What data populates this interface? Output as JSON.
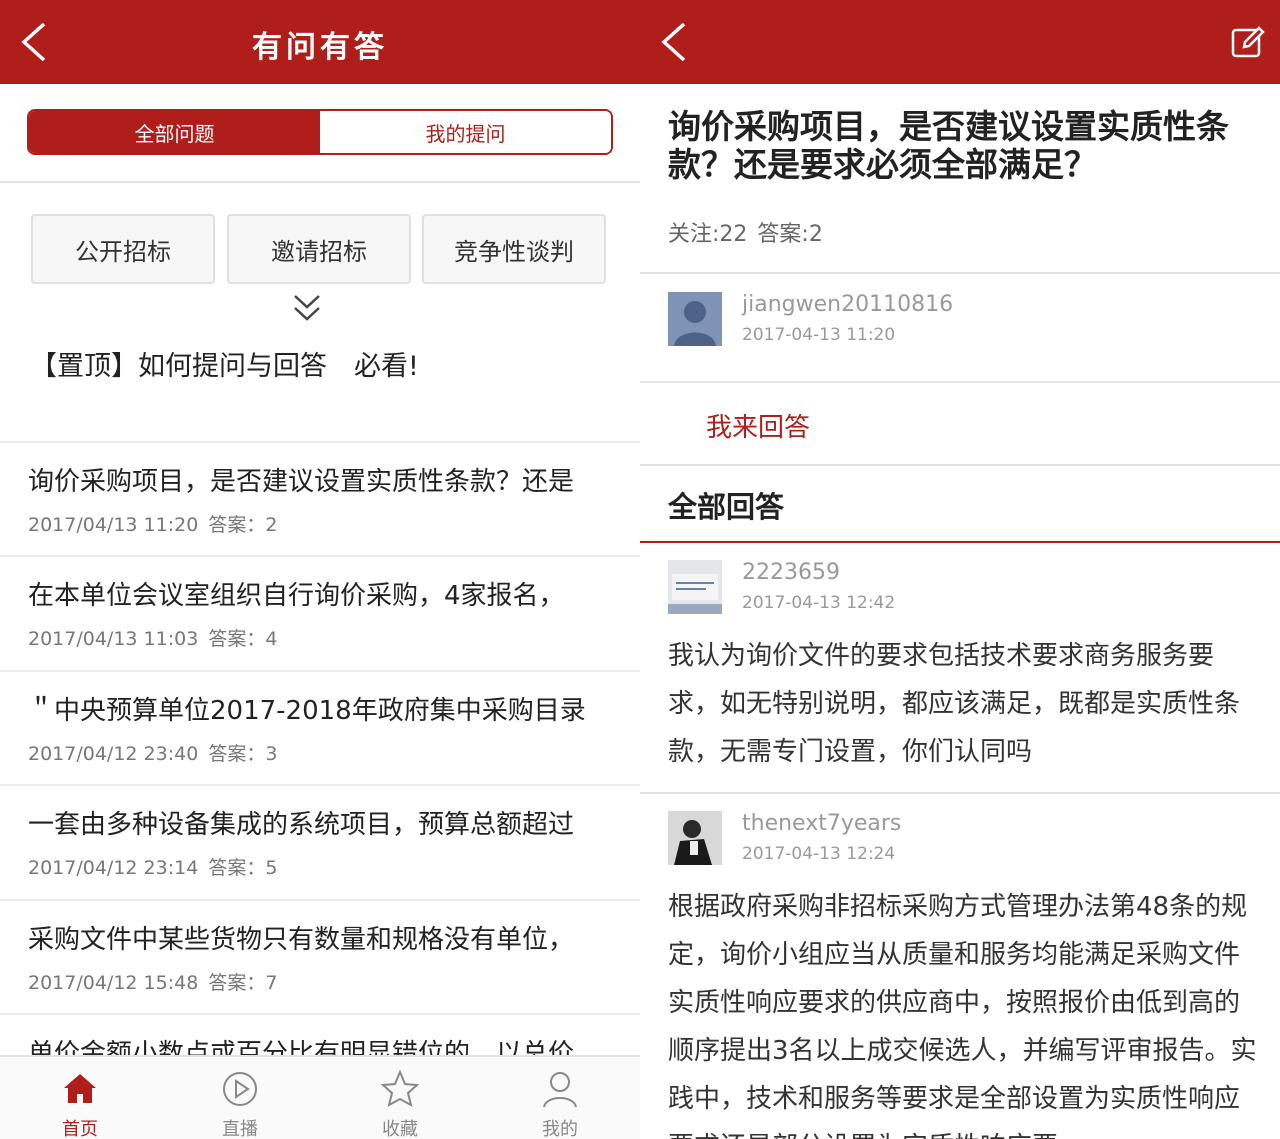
{
  "left": {
    "title": "有问有答",
    "tabs": [
      "全部问题",
      "我的提问"
    ],
    "categories": [
      "公开招标",
      "邀请招标",
      "竞争性谈判"
    ],
    "pinned": "【置顶】如何提问与回答　必看!",
    "questions": [
      {
        "title": "询价采购项目，是否建议设置实质性条款？还是",
        "date": "2017/04/13 11:20",
        "answers": "答案：2"
      },
      {
        "title": "在本单位会议室组织自行询价采购，4家报名，",
        "date": "2017/04/13 11:03",
        "answers": "答案：4"
      },
      {
        "title": "＂中央预算单位2017-2018年政府集中采购目录",
        "date": "2017/04/12 23:40",
        "answers": "答案：3"
      },
      {
        "title": "一套由多种设备集成的系统项目，预算总额超过",
        "date": "2017/04/12 23:14",
        "answers": "答案：5"
      },
      {
        "title": "采购文件中某些货物只有数量和规格没有单位，",
        "date": "2017/04/12 15:48",
        "answers": "答案：7"
      },
      {
        "title": "单价金额小数点或百分比有明显错位的，以总价",
        "date": "",
        "answers": ""
      }
    ],
    "tabbar": [
      {
        "label": "首页",
        "icon": "home-icon"
      },
      {
        "label": "直播",
        "icon": "play-icon"
      },
      {
        "label": "收藏",
        "icon": "star-icon"
      },
      {
        "label": "我的",
        "icon": "user-icon"
      }
    ]
  },
  "right": {
    "question_title": "询价采购项目，是否建议设置实质性条款？还是要求必须全部满足？",
    "follow": "关注:22",
    "answer_count": "答案:2",
    "asker": {
      "name": "jiangwen20110816",
      "time": "2017-04-13 11:20"
    },
    "answer_button": "我来回答",
    "all_answers_label": "全部回答",
    "answers": [
      {
        "name": "2223659",
        "time": "2017-04-13 12:42",
        "text": "我认为询价文件的要求包括技术要求商务服务要求，如无特别说明，都应该满足，既都是实质性条款，无需专门设置，你们认同吗"
      },
      {
        "name": "thenext7years",
        "time": "2017-04-13 12:24",
        "text": "根据政府采购非招标采购方式管理办法第48条的规定，询价小组应当从质量和服务均能满足采购文件实质性响应要求的供应商中，按照报价由低到高的顺序提出3名以上成交候选人，并编写评审报告。实践中，技术和服务等要求是全部设置为实质性响应要求还是部分设置为实质性响应要"
      }
    ]
  },
  "colors": {
    "brand_red": "#b01e1c"
  }
}
